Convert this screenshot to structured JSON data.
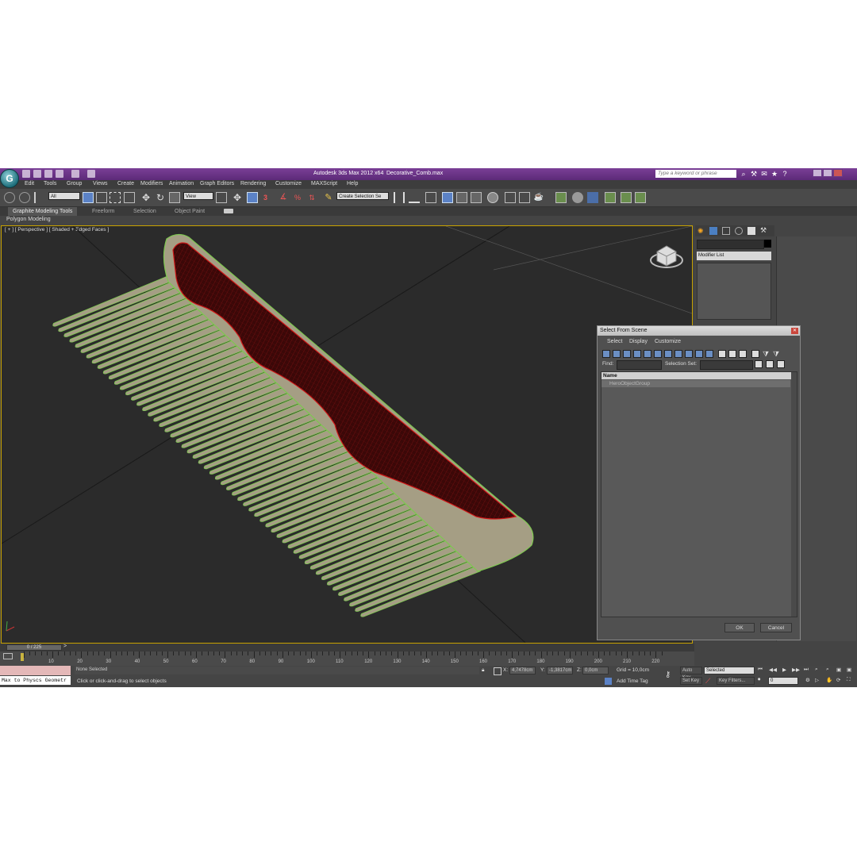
{
  "window": {
    "app_title": "Autodesk 3ds Max  2012 x64",
    "file_name": "Decorative_Comb.max",
    "search_placeholder": "Type a keyword or phrase"
  },
  "menu": [
    "Edit",
    "Tools",
    "Group",
    "Views",
    "Create",
    "Modifiers",
    "Animation",
    "Graph Editors",
    "Rendering",
    "Customize",
    "MAXScript",
    "Help"
  ],
  "toolbar": {
    "selection_filter": "All",
    "reference_coord": "View",
    "named_selection": "Create Selection Se",
    "snap_label": "3"
  },
  "ribbon": {
    "tabs": [
      "Graphite Modeling Tools",
      "Freeform",
      "Selection",
      "Object Paint"
    ],
    "active_tab": "Graphite Modeling Tools",
    "panel_label": "Polygon Modeling"
  },
  "viewport": {
    "label": "[ + ] [ Perspective ] [ Shaded + Edged Faces ]"
  },
  "command_panel": {
    "modifier_list": "Modifier List"
  },
  "dialog": {
    "title": "Select From Scene",
    "menu": [
      "Select",
      "Display",
      "Customize"
    ],
    "find_label": "Find:",
    "selection_set_label": "Selection Set:",
    "column_name": "Name",
    "items": [
      "HeroObjectGroup"
    ],
    "ok": "OK",
    "cancel": "Cancel"
  },
  "timeline": {
    "frame_display": "0 / 225",
    "ticks": [
      "10",
      "20",
      "30",
      "40",
      "50",
      "60",
      "70",
      "80",
      "90",
      "100",
      "110",
      "120",
      "130",
      "140",
      "150",
      "160",
      "170",
      "180",
      "190",
      "200",
      "210",
      "220"
    ]
  },
  "status": {
    "maxscript_listener": "Max to Physcs Geometr",
    "selection_status": "None Selected",
    "prompt": "Click or click-and-drag to select objects",
    "x_label": "X:",
    "x_value": "4,7478cm",
    "y_label": "Y:",
    "y_value": "-1,3817cm",
    "z_label": "Z:",
    "z_value": "0,0cm",
    "grid": "Grid = 10,0cm",
    "add_time_tag": "Add Time Tag",
    "auto_key": "Auto Key",
    "set_key": "Set Key",
    "key_mode": "Selected",
    "key_filters": "Key Filters...",
    "current_frame": "0"
  },
  "colors": {
    "title_bar": "#6a3388",
    "viewport_bg": "#2b2b2b",
    "comb_fill": "#a59e84",
    "comb_wire": "#7ec850",
    "selection_wire": "#c81414",
    "active_border": "#c8a200"
  }
}
